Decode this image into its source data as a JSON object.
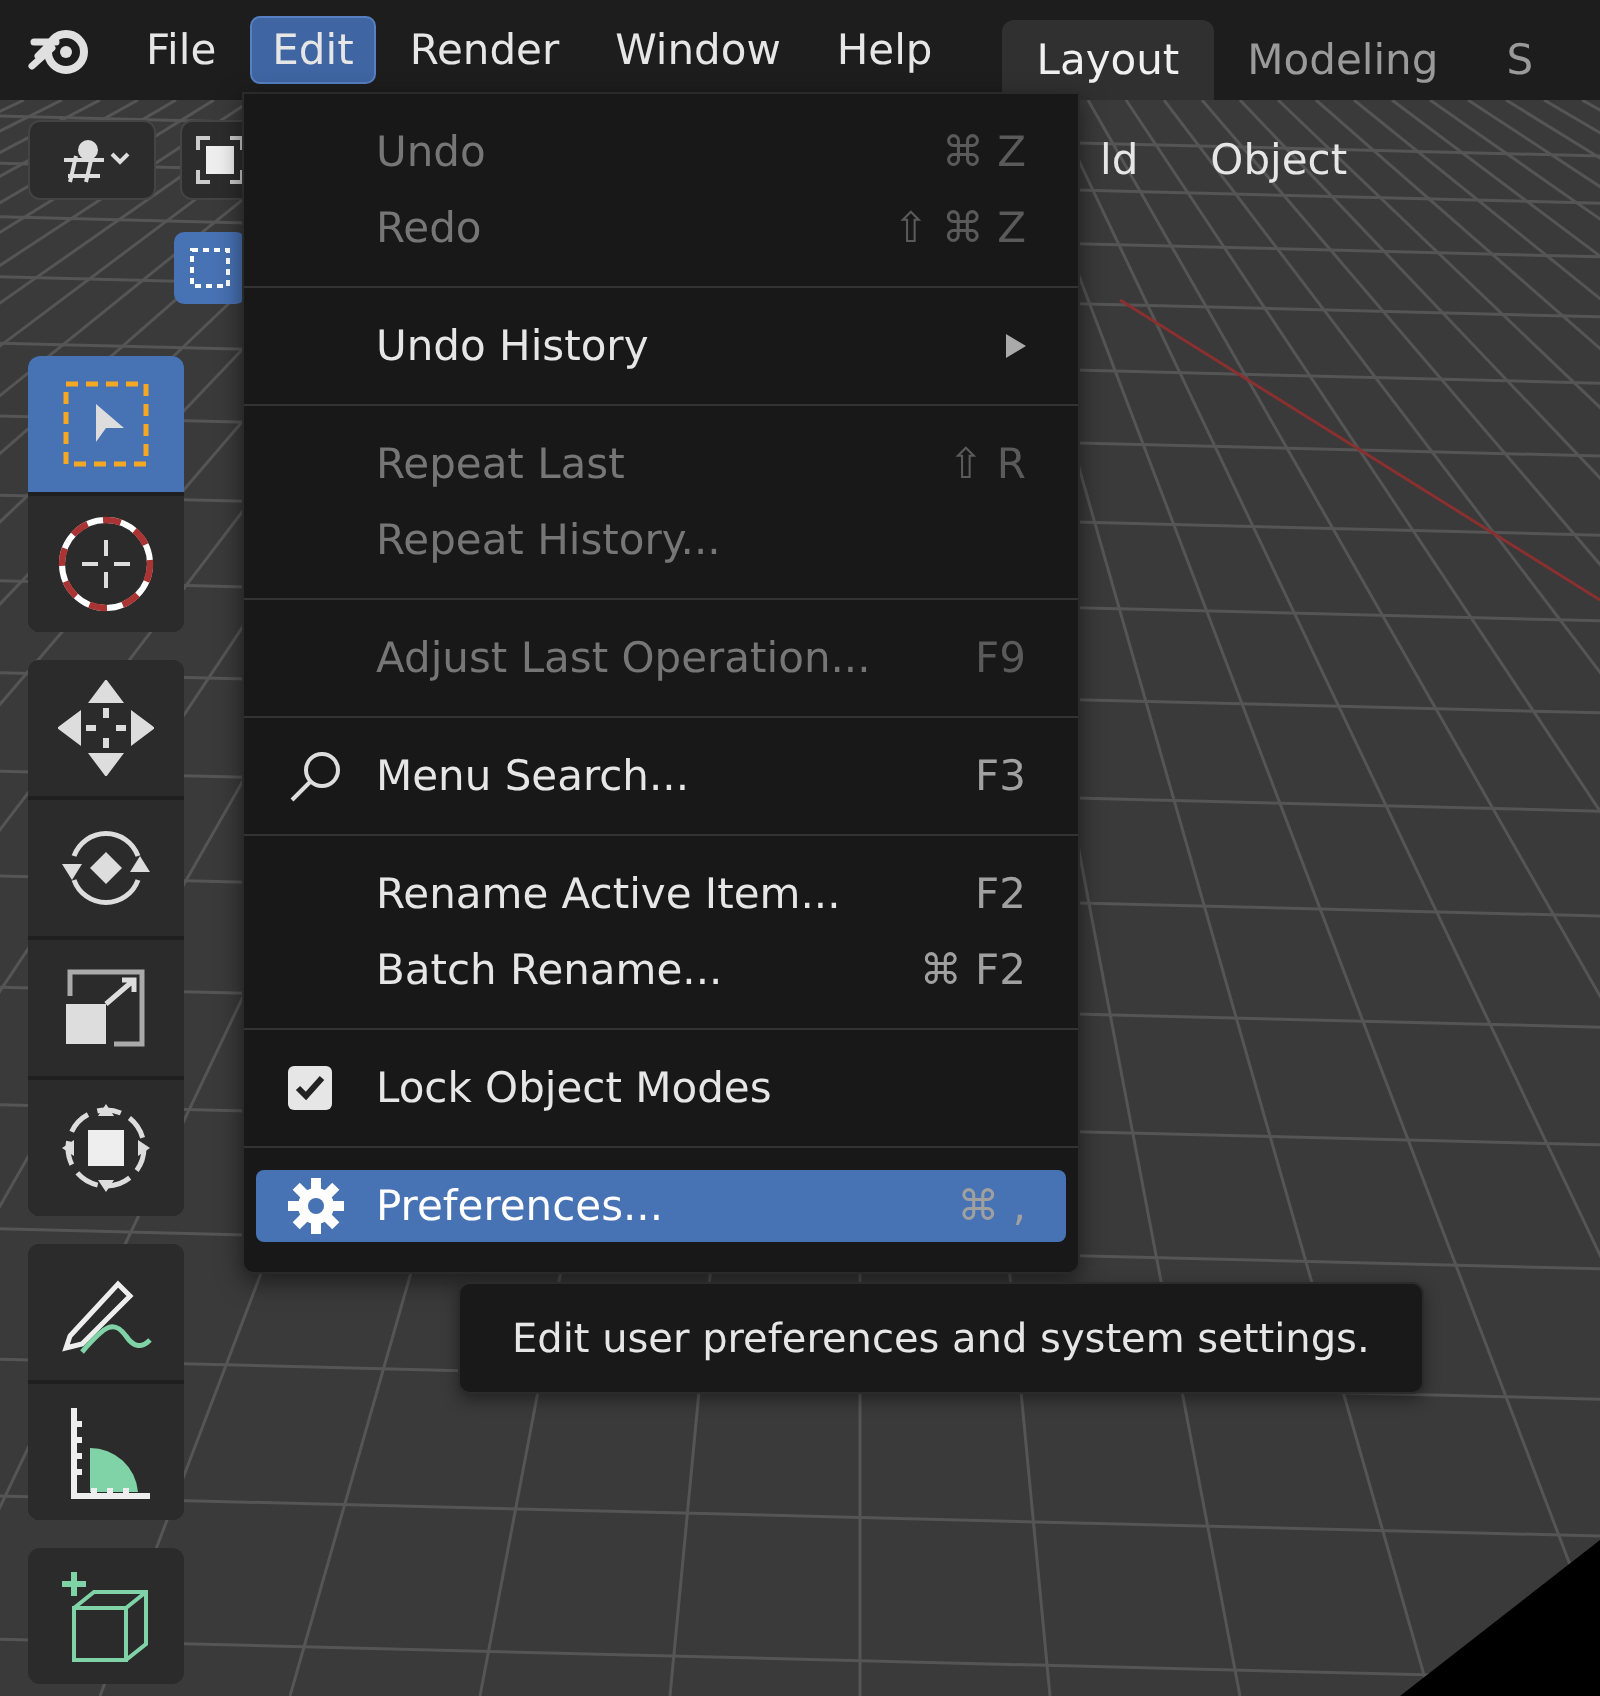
{
  "topbar": {
    "menus": [
      {
        "label": "File",
        "selected": false
      },
      {
        "label": "Edit",
        "selected": true
      },
      {
        "label": "Render",
        "selected": false
      },
      {
        "label": "Window",
        "selected": false
      },
      {
        "label": "Help",
        "selected": false
      }
    ],
    "workspaces": [
      {
        "label": "Layout",
        "selected": true
      },
      {
        "label": "Modeling",
        "selected": false
      },
      {
        "label": "S",
        "selected": false
      }
    ]
  },
  "header": {
    "menus": [
      {
        "label": "ld"
      },
      {
        "label": "Object"
      }
    ]
  },
  "toolbar": {
    "groups": [
      {
        "tools": [
          {
            "kind": "select",
            "selected": true
          },
          {
            "kind": "cursor",
            "selected": false
          }
        ]
      },
      {
        "tools": [
          {
            "kind": "move",
            "selected": false
          },
          {
            "kind": "rotate",
            "selected": false
          },
          {
            "kind": "scale",
            "selected": false
          },
          {
            "kind": "transform",
            "selected": false
          }
        ]
      },
      {
        "tools": [
          {
            "kind": "annotate",
            "selected": false
          },
          {
            "kind": "measure",
            "selected": false
          }
        ]
      },
      {
        "tools": [
          {
            "kind": "addcube",
            "selected": false
          }
        ]
      }
    ]
  },
  "edit_menu": {
    "groups": [
      {
        "items": [
          {
            "label": "Undo",
            "shortcut": "⌘ Z",
            "kind": "plain",
            "disabled": true,
            "selected": false
          },
          {
            "label": "Redo",
            "shortcut": "⇧ ⌘ Z",
            "kind": "plain",
            "disabled": true,
            "selected": false
          }
        ]
      },
      {
        "items": [
          {
            "label": "Undo History",
            "kind": "submenu",
            "disabled": false,
            "selected": false
          }
        ]
      },
      {
        "items": [
          {
            "label": "Repeat Last",
            "shortcut": "⇧ R",
            "kind": "plain",
            "disabled": true,
            "selected": false
          },
          {
            "label": "Repeat History...",
            "kind": "plain",
            "disabled": true,
            "selected": false
          }
        ]
      },
      {
        "items": [
          {
            "label": "Adjust Last Operation...",
            "shortcut": "F9",
            "kind": "plain",
            "disabled": true,
            "selected": false
          }
        ]
      },
      {
        "items": [
          {
            "label": "Menu Search...",
            "shortcut": "F3",
            "kind": "search",
            "disabled": false,
            "selected": false
          }
        ]
      },
      {
        "items": [
          {
            "label": "Rename Active Item...",
            "shortcut": "F2",
            "kind": "plain",
            "disabled": false,
            "selected": false
          },
          {
            "label": "Batch Rename...",
            "shortcut": "⌘ F2",
            "kind": "plain",
            "disabled": false,
            "selected": false
          }
        ]
      },
      {
        "items": [
          {
            "label": "Lock Object Modes",
            "kind": "check",
            "checked": true,
            "disabled": false,
            "selected": false
          }
        ]
      },
      {
        "items": [
          {
            "label": "Preferences...",
            "shortcut": "⌘ ,",
            "kind": "settings",
            "disabled": false,
            "selected": true
          }
        ]
      }
    ]
  },
  "tooltip": {
    "text": "Edit user preferences and system settings."
  }
}
